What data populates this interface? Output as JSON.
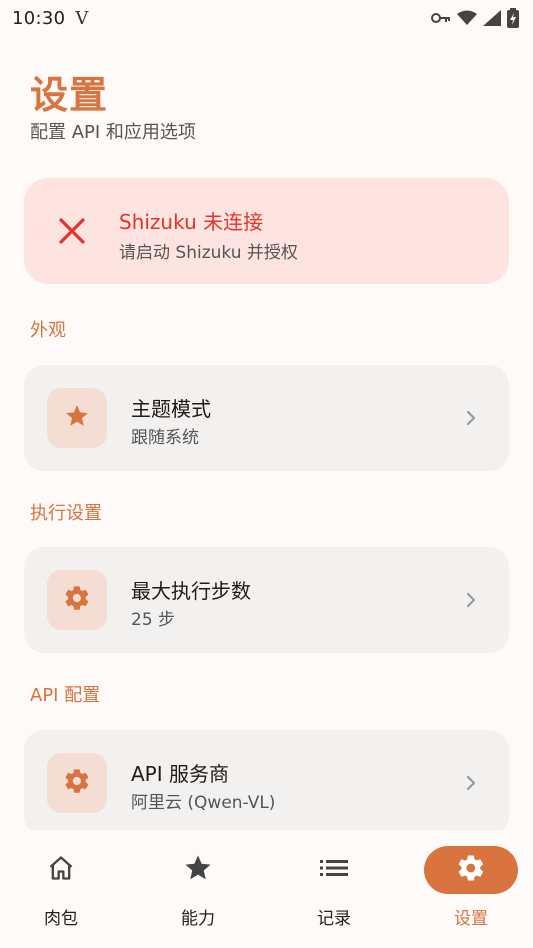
{
  "status_bar": {
    "time": "10:30",
    "carrier_glyph": "V",
    "icons": [
      "key-icon",
      "wifi-icon",
      "signal-icon",
      "battery-charging-icon"
    ]
  },
  "header": {
    "title": "设置",
    "subtitle": "配置 API 和应用选项"
  },
  "shizuku_card": {
    "icon": "close-icon",
    "title": "Shizuku 未连接",
    "subtitle": "请启动 Shizuku 并授权",
    "accent": "#e5332b",
    "background": "#fde4e1"
  },
  "sections": [
    {
      "label": "外观",
      "item": {
        "icon": "star-icon",
        "title": "主题模式",
        "value": "跟随系统"
      }
    },
    {
      "label": "执行设置",
      "item": {
        "icon": "gear-icon",
        "title": "最大执行步数",
        "value": "25 步"
      }
    },
    {
      "label": "API 配置",
      "item": {
        "icon": "gear-icon",
        "title": "API 服务商",
        "value": "阿里云 (Qwen-VL)"
      }
    }
  ],
  "bottom_nav": {
    "items": [
      {
        "label": "肉包",
        "icon": "home-icon",
        "active": false
      },
      {
        "label": "能力",
        "icon": "star-icon",
        "active": false
      },
      {
        "label": "记录",
        "icon": "list-icon",
        "active": false
      },
      {
        "label": "设置",
        "icon": "gear-icon",
        "active": true
      }
    ]
  },
  "colors": {
    "accent": "#d9733f",
    "card_bg": "#f3f1f0",
    "icon_box_bg": "#f4ded3"
  }
}
